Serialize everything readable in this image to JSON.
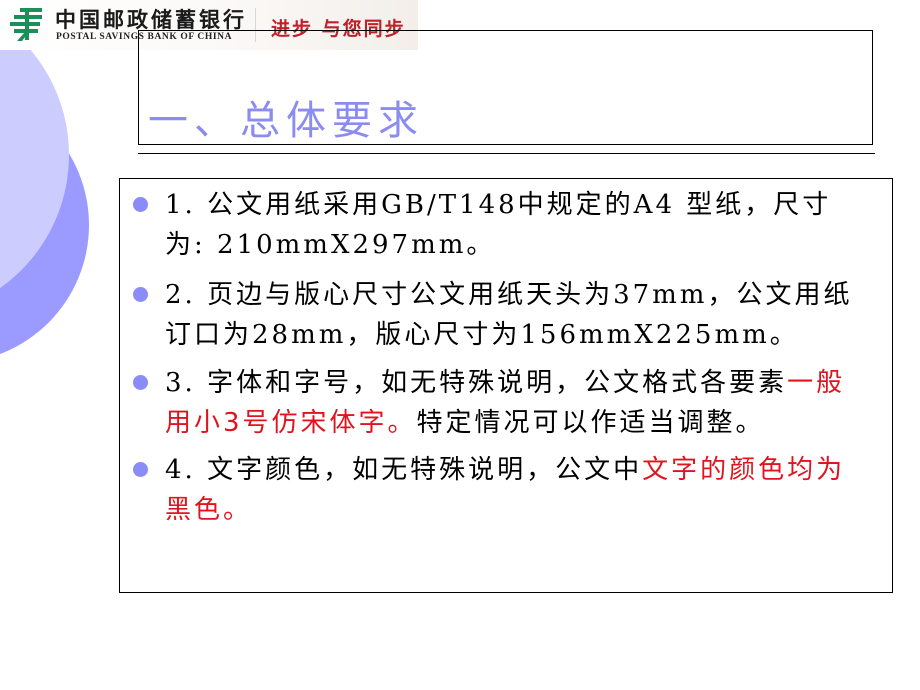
{
  "header": {
    "bank_name_cn": "中国邮政储蓄银行",
    "bank_name_en": "POSTAL SAVINGS BANK OF CHINA",
    "slogan": "进步 与您同步",
    "logo_icon": "postal-logo-icon",
    "logo_color": "#1a8f5a"
  },
  "slide": {
    "title": "一、总体要求",
    "title_color": "#8c8cf0",
    "accent_color": "#e0141e",
    "items": [
      {
        "segments": [
          {
            "text": "1. 公文用纸采用GB/T148中规定的A4 型纸，尺寸为: 210mmX297mm。",
            "highlight": false
          }
        ]
      },
      {
        "segments": [
          {
            "text": "2. 页边与版心尺寸公文用纸天头为37mm，公文用纸订口为28mm，版心尺寸为156mmX225mm。",
            "highlight": false
          }
        ]
      },
      {
        "segments": [
          {
            "text": "3. 字体和字号，如无特殊说明，公文格式各要素",
            "highlight": false
          },
          {
            "text": "一般用小3号仿宋体字。",
            "highlight": true
          },
          {
            "text": "特定情况可以作适当调整。",
            "highlight": false
          }
        ]
      },
      {
        "segments": [
          {
            "text": "4. 文字颜色，如无特殊说明，公文中",
            "highlight": false
          },
          {
            "text": "文字的颜色均为黑色。",
            "highlight": true
          }
        ]
      }
    ]
  }
}
